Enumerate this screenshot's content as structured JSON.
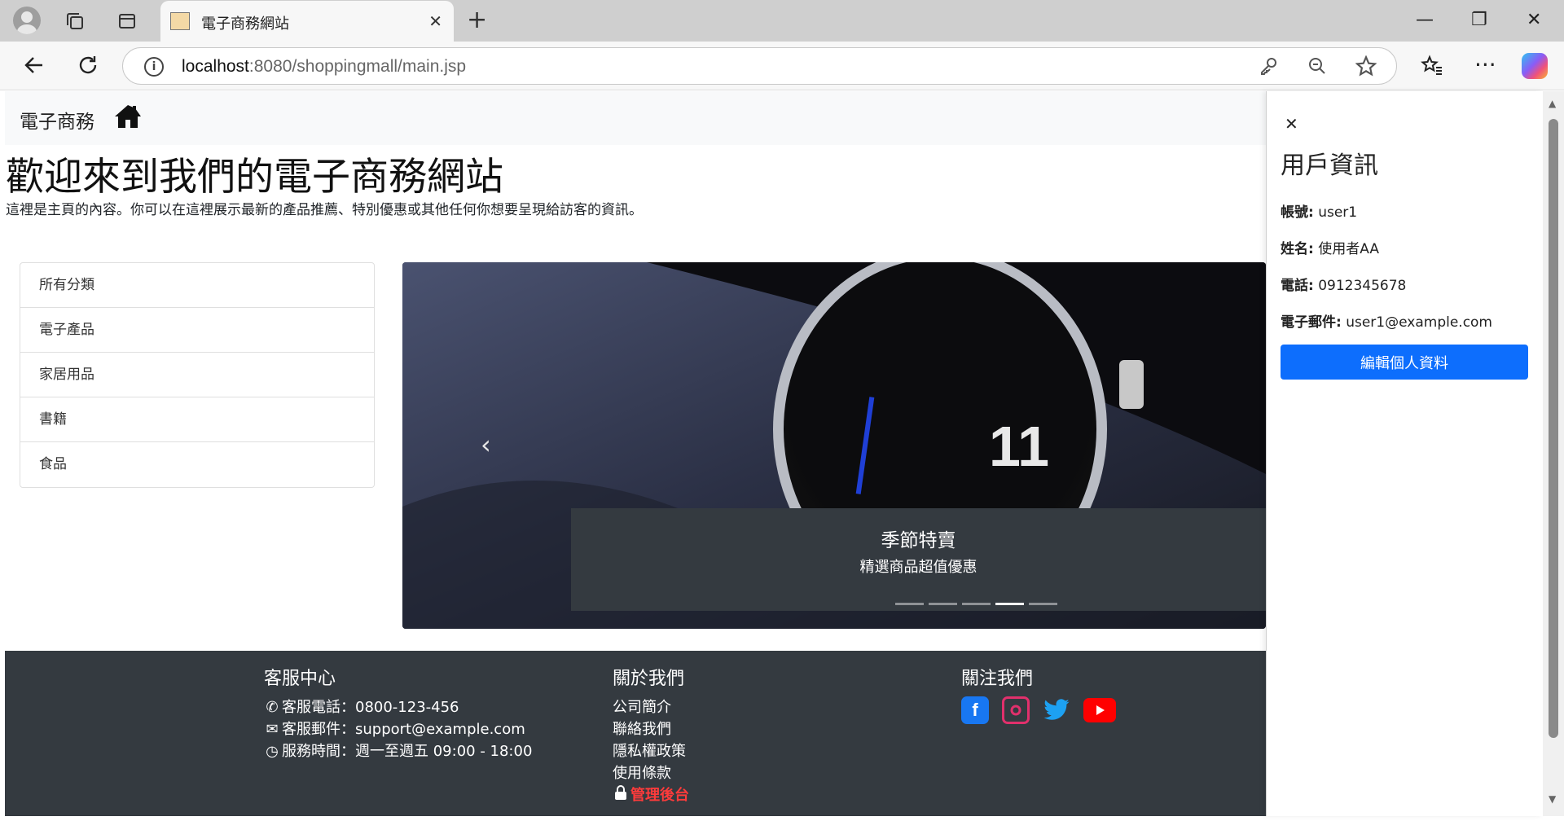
{
  "browser": {
    "tab_title": "電子商務網站",
    "url_host": "localhost",
    "url_rest": ":8080/shoppingmall/main.jsp"
  },
  "navbar": {
    "brand": "電子商務"
  },
  "hero": {
    "title": "歡迎來到我們的電子商務網站",
    "subtitle": "這裡是主頁的內容。你可以在這裡展示最新的產品推薦、特別優惠或其他任何你想要呈現給訪客的資訊。"
  },
  "categories": [
    "所有分類",
    "電子產品",
    "家居用品",
    "書籍",
    "食品"
  ],
  "carousel": {
    "caption_title": "季節特賣",
    "caption_text": "精選商品超值優惠",
    "indicator_count": 5,
    "active_index": 3
  },
  "footer": {
    "service": {
      "heading": "客服中心",
      "phone": "客服電話：0800-123-456",
      "email": "客服郵件：support@example.com",
      "hours": "服務時間：週一至週五 09:00 - 18:00"
    },
    "about": {
      "heading": "關於我們",
      "links": [
        "公司簡介",
        "聯絡我們",
        "隱私權政策",
        "使用條款"
      ],
      "admin": "管理後台"
    },
    "follow": {
      "heading": "關注我們",
      "icons": [
        "facebook-icon",
        "instagram-icon",
        "twitter-icon",
        "youtube-icon"
      ],
      "colors": {
        "facebook": "#1877f2",
        "instagram": "#e1306c",
        "twitter": "#1da1f2",
        "youtube": "#ff0000"
      }
    }
  },
  "offcanvas": {
    "title": "用戶資訊",
    "account_label": "帳號:",
    "account": "user1",
    "name_label": "姓名:",
    "name": "使用者AA",
    "phone_label": "電話:",
    "phone": "0912345678",
    "email_label": "電子郵件:",
    "email": "user1@example.com",
    "edit_button": "編輯個人資料"
  },
  "colors": {
    "primary": "#0d6efd",
    "footer_bg": "#343a40",
    "admin_link": "#ff3b3b"
  }
}
